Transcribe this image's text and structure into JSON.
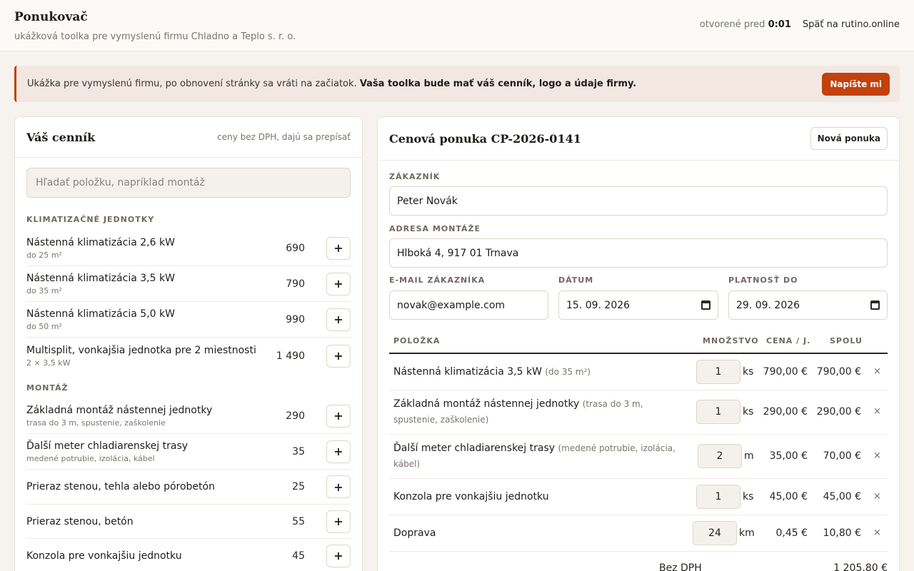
{
  "header": {
    "title": "Ponukovač",
    "subtitle": "ukážková toolka pre vymyslenú firmu Chladno a Teplo s. r. o.",
    "opened_label": "otvorené pred",
    "opened_time": "0:01",
    "back_link": "Späť na rutino.online"
  },
  "banner": {
    "text": "Ukážka pre vymyslenú firmu, po obnovení stránky sa vráti na začiatok.",
    "bold_text": "Vaša toolka bude mať váš cenník, logo a údaje firmy.",
    "button": "Napíšte mi"
  },
  "pricelist": {
    "title": "Váš cenník",
    "note": "ceny bez DPH, dajú sa prepísať",
    "search_placeholder": "Hľadať položku, napríklad montáž",
    "categories": [
      {
        "label": "KLIMATIZAČNÉ JEDNOTKY",
        "items": [
          {
            "name": "Nástenná klimatizácia 2,6 kW",
            "sub": "do 25 m²",
            "price": "690"
          },
          {
            "name": "Nástenná klimatizácia 3,5 kW",
            "sub": "do 35 m²",
            "price": "790"
          },
          {
            "name": "Nástenná klimatizácia 5,0 kW",
            "sub": "do 50 m²",
            "price": "990"
          },
          {
            "name": "Multisplit, vonkajšia jednotka pre 2 miestnosti",
            "sub": "2 × 3,5 kW",
            "price": "1 490"
          }
        ]
      },
      {
        "label": "MONTÁŽ",
        "items": [
          {
            "name": "Základná montáž nástennej jednotky",
            "sub": "trasa do 3 m, spustenie, zaškolenie",
            "price": "290"
          },
          {
            "name": "Ďalší meter chladiarenskej trasy",
            "sub": "medené potrubie, izolácia, kábel",
            "price": "35"
          },
          {
            "name": "Prieraz stenou, tehla alebo pórobetón",
            "sub": "",
            "price": "25"
          },
          {
            "name": "Prieraz stenou, betón",
            "sub": "",
            "price": "55"
          },
          {
            "name": "Konzola pre vonkajšiu jednotku",
            "sub": "",
            "price": "45"
          }
        ]
      }
    ],
    "add_symbol": "+"
  },
  "quote": {
    "title": "Cenová ponuka CP-2026-0141",
    "new_button": "Nová ponuka",
    "customer_label": "ZÁKAZNÍK",
    "customer_value": "Peter Novák",
    "address_label": "ADRESA MONTÁŽE",
    "address_value": "Hlboká 4, 917 01 Trnava",
    "email_label": "E-MAIL ZÁKAZNÍKA",
    "email_value": "novak@example.com",
    "date_label": "DÁTUM",
    "date_value": "15. 09. 2026",
    "valid_label": "PLATNOSŤ DO",
    "valid_value": "29. 09. 2026",
    "columns": {
      "item": "POLOŽKA",
      "qty": "MNOŽSTVO",
      "unit_price": "CENA / J.",
      "total": "SPOLU"
    },
    "rows": [
      {
        "name": "Nástenná klimatizácia 3,5 kW",
        "note": "(do 35 m²)",
        "qty": "1",
        "unit": "ks",
        "price": "790,00 €",
        "total": "790,00 €"
      },
      {
        "name": "Základná montáž nástennej jednotky",
        "note": "(trasa do 3 m, spustenie, zaškolenie)",
        "qty": "1",
        "unit": "ks",
        "price": "290,00 €",
        "total": "290,00 €"
      },
      {
        "name": "Ďalší meter chladiarenskej trasy",
        "note": "(medené potrubie, izolácia, kábel)",
        "qty": "2",
        "unit": "m",
        "price": "35,00 €",
        "total": "70,00 €"
      },
      {
        "name": "Konzola pre vonkajšiu jednotku",
        "note": "",
        "qty": "1",
        "unit": "ks",
        "price": "45,00 €",
        "total": "45,00 €"
      },
      {
        "name": "Doprava",
        "note": "",
        "qty": "24",
        "unit": "km",
        "price": "0,45 €",
        "total": "10,80 €"
      }
    ],
    "remove_symbol": "×",
    "subtotal_label": "Bez DPH",
    "subtotal_value": "1 205,80 €"
  }
}
